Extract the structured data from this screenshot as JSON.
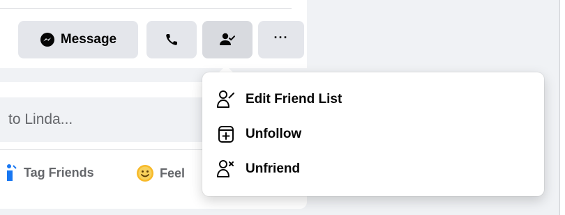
{
  "profile_actions": {
    "message_label": "Message",
    "message_icon": "messenger-icon",
    "call_icon": "phone-icon",
    "friends_icon": "person-check-icon",
    "more_label": "···"
  },
  "composer": {
    "placeholder_fragment": "to Linda...",
    "tag_friends_label": "Tag Friends",
    "feeling_label_fragment": "Feel"
  },
  "friends_menu": {
    "items": [
      {
        "label": "Edit Friend List",
        "icon": "edit-friend-list-icon"
      },
      {
        "label": "Unfollow",
        "icon": "unfollow-icon"
      },
      {
        "label": "Unfriend",
        "icon": "unfriend-icon"
      }
    ]
  },
  "colors": {
    "button_bg": "#e4e6eb",
    "page_bg": "#f0f2f5",
    "tag_blue": "#1877f2",
    "feeling_yellow": "#f7b928",
    "secondary_text": "#65676b"
  }
}
